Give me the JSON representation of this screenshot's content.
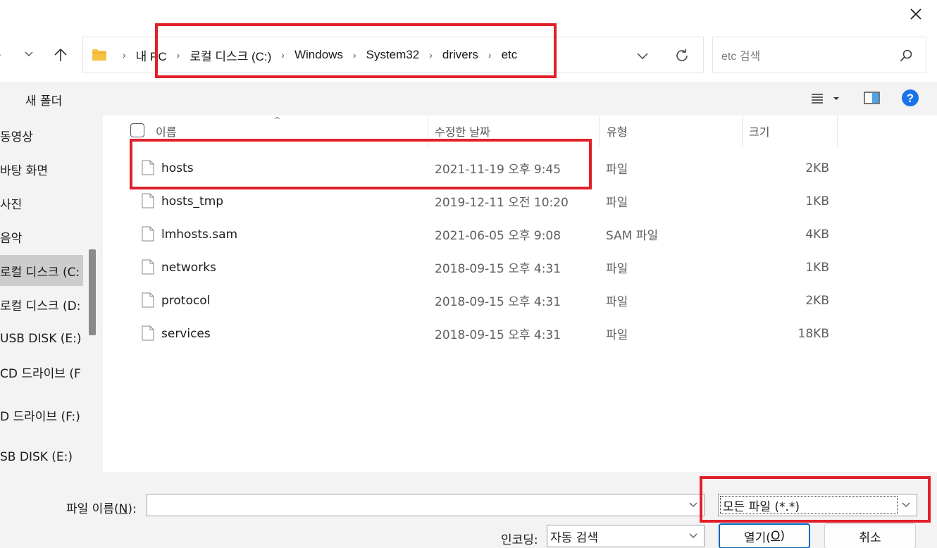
{
  "window": {
    "close_label": "✕"
  },
  "nav": {
    "forward_glyph": "›",
    "recent_glyph": "⌄",
    "up_glyph": "↑"
  },
  "address": {
    "crumbs": [
      "내 PC",
      "로컬 디스크 (C:)",
      "Windows",
      "System32",
      "drivers",
      "etc"
    ]
  },
  "search": {
    "placeholder": "etc 검색"
  },
  "toolbar": {
    "new_folder": "새 폴더"
  },
  "sidebar": {
    "items": [
      {
        "label": "동영상"
      },
      {
        "label": "바탕 화면"
      },
      {
        "label": "사진"
      },
      {
        "label": "음악"
      },
      {
        "label": "로컬 디스크 (C:"
      },
      {
        "label": "로컬 디스크 (D:"
      },
      {
        "label": "USB DISK (E:)"
      },
      {
        "label": "CD 드라이브 (F"
      },
      {
        "label": "D 드라이브 (F:)"
      },
      {
        "label": "SB DISK (E:)"
      }
    ]
  },
  "columns": {
    "name": "이름",
    "modified": "수정한 날짜",
    "type": "유형",
    "size": "크기",
    "sort_glyph": "^"
  },
  "files": [
    {
      "name": "hosts",
      "modified": "2021-11-19 오후 9:45",
      "type": "파일",
      "size": "2KB"
    },
    {
      "name": "hosts_tmp",
      "modified": "2019-12-11 오전 10:20",
      "type": "파일",
      "size": "1KB"
    },
    {
      "name": "lmhosts.sam",
      "modified": "2021-06-05 오후 9:08",
      "type": "SAM 파일",
      "size": "4KB"
    },
    {
      "name": "networks",
      "modified": "2018-09-15 오후 4:31",
      "type": "파일",
      "size": "1KB"
    },
    {
      "name": "protocol",
      "modified": "2018-09-15 오후 4:31",
      "type": "파일",
      "size": "2KB"
    },
    {
      "name": "services",
      "modified": "2018-09-15 오후 4:31",
      "type": "파일",
      "size": "18KB"
    }
  ],
  "footer": {
    "filename_label_pre": "파일 이름(",
    "filename_label_key": "N",
    "filename_label_post": "):",
    "filename_value": "",
    "filetype_value": "모든 파일  (*.*)",
    "encoding_label": "인코딩:",
    "encoding_value": "자동 검색",
    "open_pre": "열기(",
    "open_key": "O",
    "open_post": ")",
    "cancel": "취소"
  },
  "colors": {
    "highlight": "#e0202a",
    "accent": "#0067c0",
    "help": "#1a73e8"
  }
}
